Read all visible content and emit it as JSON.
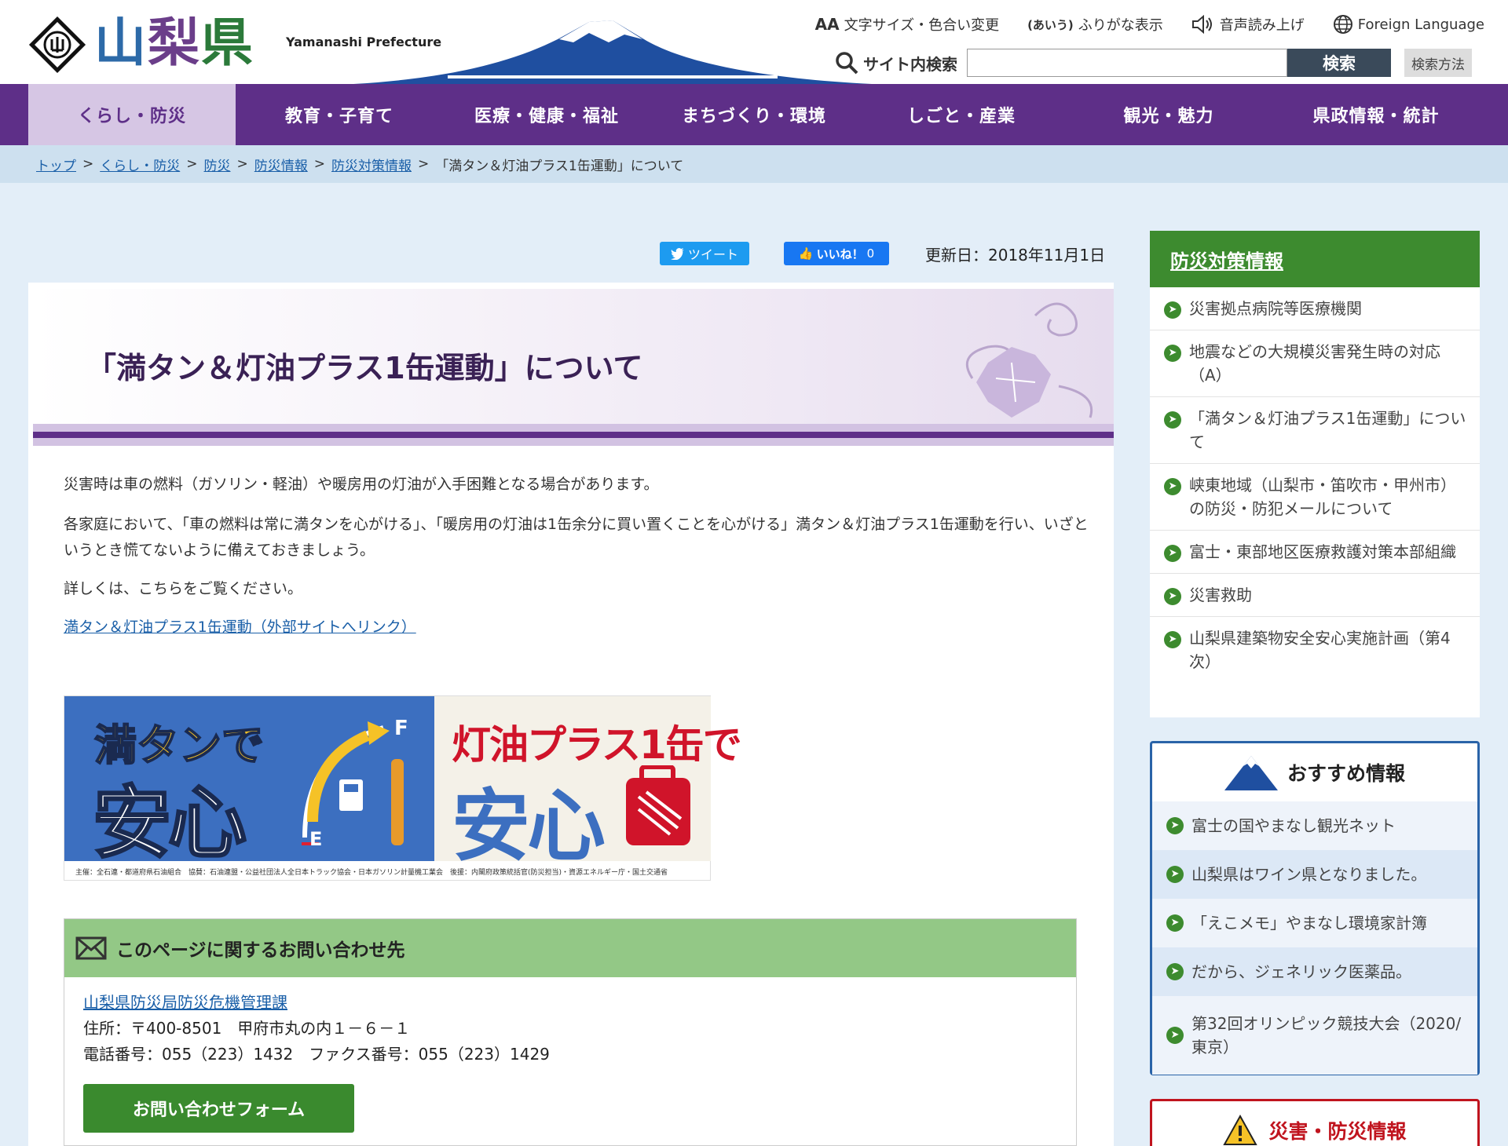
{
  "header": {
    "logo_kanji": [
      "山",
      "梨",
      "県"
    ],
    "logo_en": "Yamanashi Prefecture",
    "util": {
      "text_size": "文字サイズ・色合い変更",
      "furigana": "ふりがな表示",
      "speech": "音声読み上げ",
      "language": "Foreign Language"
    },
    "search": {
      "label": "サイト内検索",
      "button": "検索",
      "how": "検索方法",
      "placeholder": ""
    }
  },
  "nav": {
    "items": [
      "くらし・防災",
      "教育・子育て",
      "医療・健康・福祉",
      "まちづくり・環境",
      "しごと・産業",
      "観光・魅力",
      "県政情報・統計"
    ]
  },
  "breadcrumb": {
    "links": [
      "トップ",
      "くらし・防災",
      "防災",
      "防災情報",
      "防災対策情報"
    ],
    "sep": ">",
    "current": "「満タン＆灯油プラス1缶運動」について"
  },
  "social": {
    "tweet": "ツイート",
    "like": "いいね！",
    "like_count": "0",
    "updated": "更新日：2018年11月1日"
  },
  "article": {
    "title": "「満タン＆灯油プラス1缶運動」について",
    "p1": "災害時は車の燃料（ガソリン・軽油）や暖房用の灯油が入手困難となる場合があります。",
    "p2": "各家庭において、「車の燃料は常に満タンを心がける」、「暖房用の灯油は1缶余分に買い置くことを心がける」満タン＆灯油プラス1缶運動を行い、いざというとき慌てないように備えておきましょう。",
    "p3": "詳しくは、こちらをご覧ください。",
    "ext_link": "満タン＆灯油プラス1缶運動（外部サイトへリンク）",
    "banner": {
      "t1": "満タンで",
      "t2": "安心",
      "t3": "灯油プラス1缶で",
      "t4": "安心",
      "gauge_f": "F",
      "gauge_e": "E",
      "footer": "主催：全石連・都道府県石油組合　協賛：石油連盟・公益社団法人全日本トラック協会・日本ガソリン計量機工業会　後援：内閣府政策統括官(防災担当)・資源エネルギー庁・国土交通省"
    }
  },
  "contact": {
    "heading": "このページに関するお問い合わせ先",
    "dept": "山梨県防災局防災危機管理課",
    "address": "住所：〒400-8501　甲府市丸の内１－６－１",
    "phone": "電話番号：055（223）1432　ファクス番号：055（223）1429",
    "form_button": "お問い合わせフォーム"
  },
  "sidebar": {
    "section1": {
      "heading": "防災対策情報",
      "items": [
        "災害拠点病院等医療機関",
        "地震などの大規模災害発生時の対応（A）",
        "「満タン＆灯油プラス1缶運動」について",
        "峡東地域（山梨市・笛吹市・甲州市）の防災・防犯メールについて",
        "富士・東部地区医療救護対策本部組織",
        "災害救助",
        "山梨県建築物安全安心実施計画（第4次）"
      ]
    },
    "section2": {
      "heading": "おすすめ情報",
      "items": [
        "富士の国やまなし観光ネット",
        "山梨県はワイン県となりました。",
        "「えこメモ」やまなし環境家計簿",
        "だから、ジェネリック医薬品。",
        "第32回オリンピック競技大会（2020/東京）"
      ]
    },
    "section3": {
      "heading": "災害・防災情報"
    }
  },
  "colors": {
    "nav_bg": "#5e2f88",
    "nav_active_bg": "#d6c6e4",
    "sidebar_green": "#3d8b2f",
    "recommend_border": "#2a63a8",
    "disaster_red": "#c0141e",
    "contact_head": "#93c886"
  }
}
